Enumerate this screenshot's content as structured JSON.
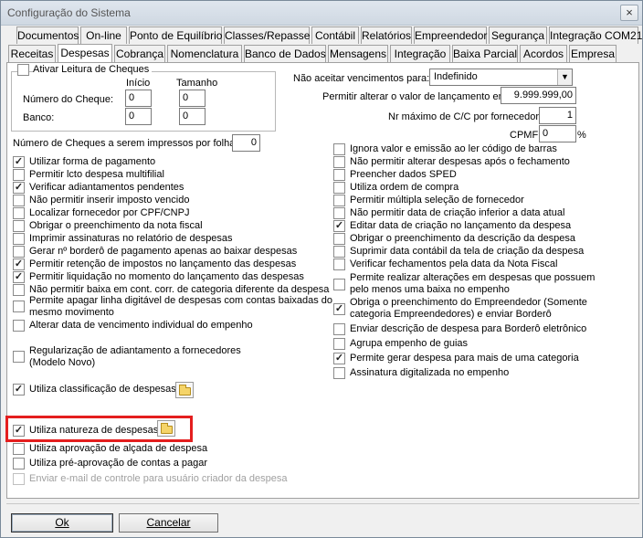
{
  "window": {
    "title": "Configuração do Sistema",
    "close_glyph": "×"
  },
  "tabs_row1": [
    "Documentos",
    "On-line",
    "Ponto de Equilíbrio",
    "Classes/Repasse",
    "Contábil",
    "Relatórios",
    "Empreendedor",
    "Segurança",
    "Integração COM21"
  ],
  "tabs_row2": [
    "Receitas",
    "Despesas",
    "Cobrança",
    "Nomenclatura",
    "Banco de Dados",
    "Mensagens",
    "Integração",
    "Baixa Parcial",
    "Acordos",
    "Empresa"
  ],
  "active_tab": "Despesas",
  "cheques": {
    "group_label": "Ativar Leitura de Cheques",
    "col_inicio": "Início",
    "col_tamanho": "Tamanho",
    "row_numero": "Número do Cheque:",
    "row_banco": "Banco:",
    "numero_inicio": "0",
    "numero_tamanho": "0",
    "banco_inicio": "0",
    "banco_tamanho": "0",
    "impressos_label": "Número de Cheques a serem impressos por folha:",
    "impressos_value": "0"
  },
  "right_fields": {
    "vencimentos_label": "Não aceitar vencimentos para:",
    "vencimentos_value": "Indefinido",
    "alterar_valor_label": "Permitir alterar o valor de lançamento em:",
    "alterar_valor_value": "9.999.999,00",
    "max_cc_label": "Nr máximo de C/C por fornecedor:",
    "max_cc_value": "1",
    "cpmf_label": "CPMF:",
    "cpmf_value": "0",
    "cpmf_unit": "%"
  },
  "left_checks": [
    {
      "label": "Utilizar forma de pagamento",
      "checked": true
    },
    {
      "label": "Permitir lcto despesa multifilial",
      "checked": false
    },
    {
      "label": "Verificar adiantamentos pendentes",
      "checked": true
    },
    {
      "label": "Não permitir inserir imposto vencido",
      "checked": false
    },
    {
      "label": "Localizar fornecedor por CPF/CNPJ",
      "checked": false
    },
    {
      "label": "Obrigar o preenchimento da nota fiscal",
      "checked": false
    },
    {
      "label": "Imprimir assinaturas no relatório de despesas",
      "checked": false
    },
    {
      "label": "Gerar nº borderô de pagamento apenas ao baixar despesas",
      "checked": false
    },
    {
      "label": "Permitir retenção de impostos no lançamento das despesas",
      "checked": true
    },
    {
      "label": "Permitir liquidação no momento do lançamento das despesas",
      "checked": true
    },
    {
      "label": "Não permitir baixa em cont. corr. de categoria diferente da despesa",
      "checked": false
    },
    {
      "label": "Permite apagar linha digitável de despesas com contas baixadas do",
      "label2": "mesmo movimento",
      "checked": false
    },
    {
      "label": "Alterar data de vencimento individual do empenho",
      "checked": false
    },
    {
      "label": "Regularização de adiantamento a fornecedores",
      "label2": "(Modelo Novo)",
      "checked": false
    },
    {
      "label": "Utiliza classificação de despesas",
      "checked": true
    },
    {
      "label": "Utiliza natureza de despesas",
      "checked": true
    },
    {
      "label": "Utiliza aprovação de alçada de despesa",
      "checked": false
    },
    {
      "label": "Utiliza pré-aprovação de contas a pagar",
      "checked": false
    },
    {
      "label": "Enviar e-mail de controle para usuário criador da despesa",
      "checked": false,
      "disabled": true
    }
  ],
  "right_checks": [
    {
      "label": "Ignora valor e emissão ao ler código de barras",
      "checked": false
    },
    {
      "label": "Não permitir alterar despesas após o fechamento",
      "checked": false
    },
    {
      "label": "Preencher dados SPED",
      "checked": false
    },
    {
      "label": "Utiliza ordem de compra",
      "checked": false
    },
    {
      "label": "Permitir múltipla seleção de fornecedor",
      "checked": false
    },
    {
      "label": "Não permitir data de criação inferior a data atual",
      "checked": false
    },
    {
      "label": "Editar data de criação no lançamento da despesa",
      "checked": true
    },
    {
      "label": "Obrigar o preenchimento da descrição da despesa",
      "checked": false
    },
    {
      "label": "Suprimir data contábil da tela de criação da despesa",
      "checked": false
    },
    {
      "label": "Verificar fechamentos pela data da Nota Fiscal",
      "checked": false
    },
    {
      "label": "Permite realizar alterações em despesas que possuem",
      "label2": "pelo menos uma baixa no empenho",
      "checked": false
    },
    {
      "label": "Obriga o preenchimento do Empreendedor (Somente",
      "label2": "categoria Empreendedores) e enviar Borderô",
      "checked": true
    },
    {
      "label": "Enviar descrição de despesa para Borderô eletrônico",
      "checked": false
    },
    {
      "label": "Agrupa empenho de guias",
      "checked": false
    },
    {
      "label": "Permite gerar despesa para mais de uma categoria",
      "checked": true
    },
    {
      "label": "Assinatura digitalizada no empenho",
      "checked": false
    }
  ],
  "buttons": {
    "ok": "Ok",
    "cancel": "Cancelar"
  },
  "colors": {
    "highlight": "#e41e1e",
    "panel_bg": "#ffffff",
    "window_bg": "#f0f0f0"
  }
}
